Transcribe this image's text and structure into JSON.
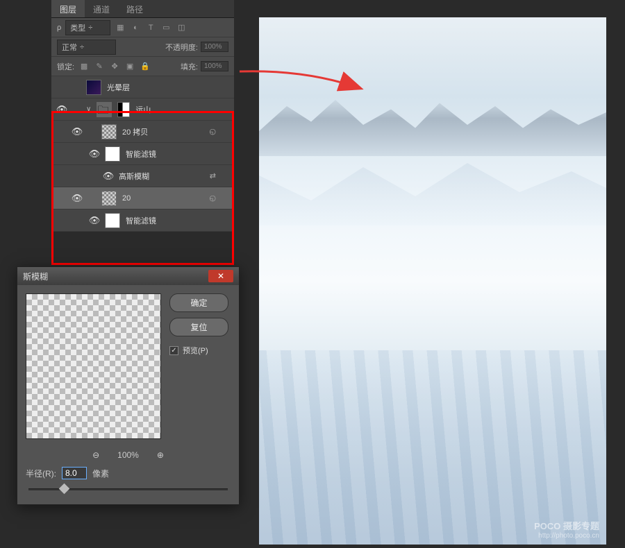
{
  "tabs": {
    "layers": "图层",
    "channels": "通道",
    "paths": "路径"
  },
  "filter_row": {
    "kind": "类型"
  },
  "blend_row": {
    "mode": "正常",
    "opacity_label": "不透明度:",
    "opacity_value": "100%"
  },
  "lock_row": {
    "label": "锁定:",
    "fill_label": "填充:",
    "fill_value": "100%"
  },
  "layers": {
    "glow": "光晕层",
    "group": "远山",
    "copy": "20 拷贝",
    "smart_filter": "智能滤镜",
    "gauss": "高斯模糊",
    "layer20": "20",
    "smart_filter2": "智能滤镜"
  },
  "dialog": {
    "title": "斯模糊",
    "ok": "确定",
    "reset": "复位",
    "preview": "预览(P)",
    "zoom": "100%",
    "radius_label": "半径(R):",
    "radius_value": "8.0",
    "radius_unit": "像素"
  },
  "watermark": {
    "brand": "POCO 摄影专题",
    "url": "http://photo.poco.cn"
  }
}
